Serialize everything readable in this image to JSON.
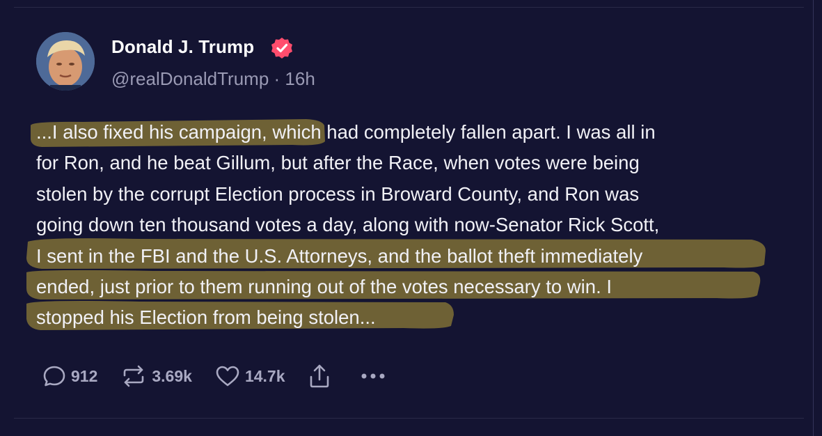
{
  "post": {
    "author_name": "Donald J. Trump",
    "handle": "@realDonaldTrump",
    "separator": " · ",
    "time_ago": "16h",
    "lines": [
      {
        "before": "",
        "highlight": "...I also fixed his campaign, w",
        "after": "hich had completely fallen apart. I was all in"
      },
      {
        "before": "for Ron, and he beat Gillum, but after the Race, when votes were being",
        "highlight": "",
        "after": ""
      },
      {
        "before": "stolen by the corrupt Election process in Broward County, and Ron was",
        "highlight": "",
        "after": ""
      },
      {
        "before": "going down ten thousand votes a day, along with now-Senator Rick Scott,",
        "highlight": "",
        "after": ""
      },
      {
        "before": "",
        "highlight": "I sent in the FBI and the U.S. Attorneys, and the ballot theft immediately",
        "after": ""
      },
      {
        "before": "",
        "highlight": "ended, just prior to them running out of the votes necessary to win. I",
        "after": ""
      },
      {
        "before": "",
        "highlight": "stopped his Election from being stolen...",
        "after": ""
      }
    ]
  },
  "actions": {
    "reply_count": "912",
    "repost_count": "3.69k",
    "like_count": "14.7k"
  },
  "icons": {
    "verified": "verified-badge-icon",
    "reply": "reply-bubble-icon",
    "repost": "repost-icon",
    "like": "heart-icon",
    "share": "share-icon",
    "more": "more-dots-icon"
  },
  "colors": {
    "background": "#141432",
    "highlight": "#8a7a3c",
    "verified": "#ff4d6d",
    "text": "#f1f1f6",
    "muted": "#9a9ab4"
  }
}
